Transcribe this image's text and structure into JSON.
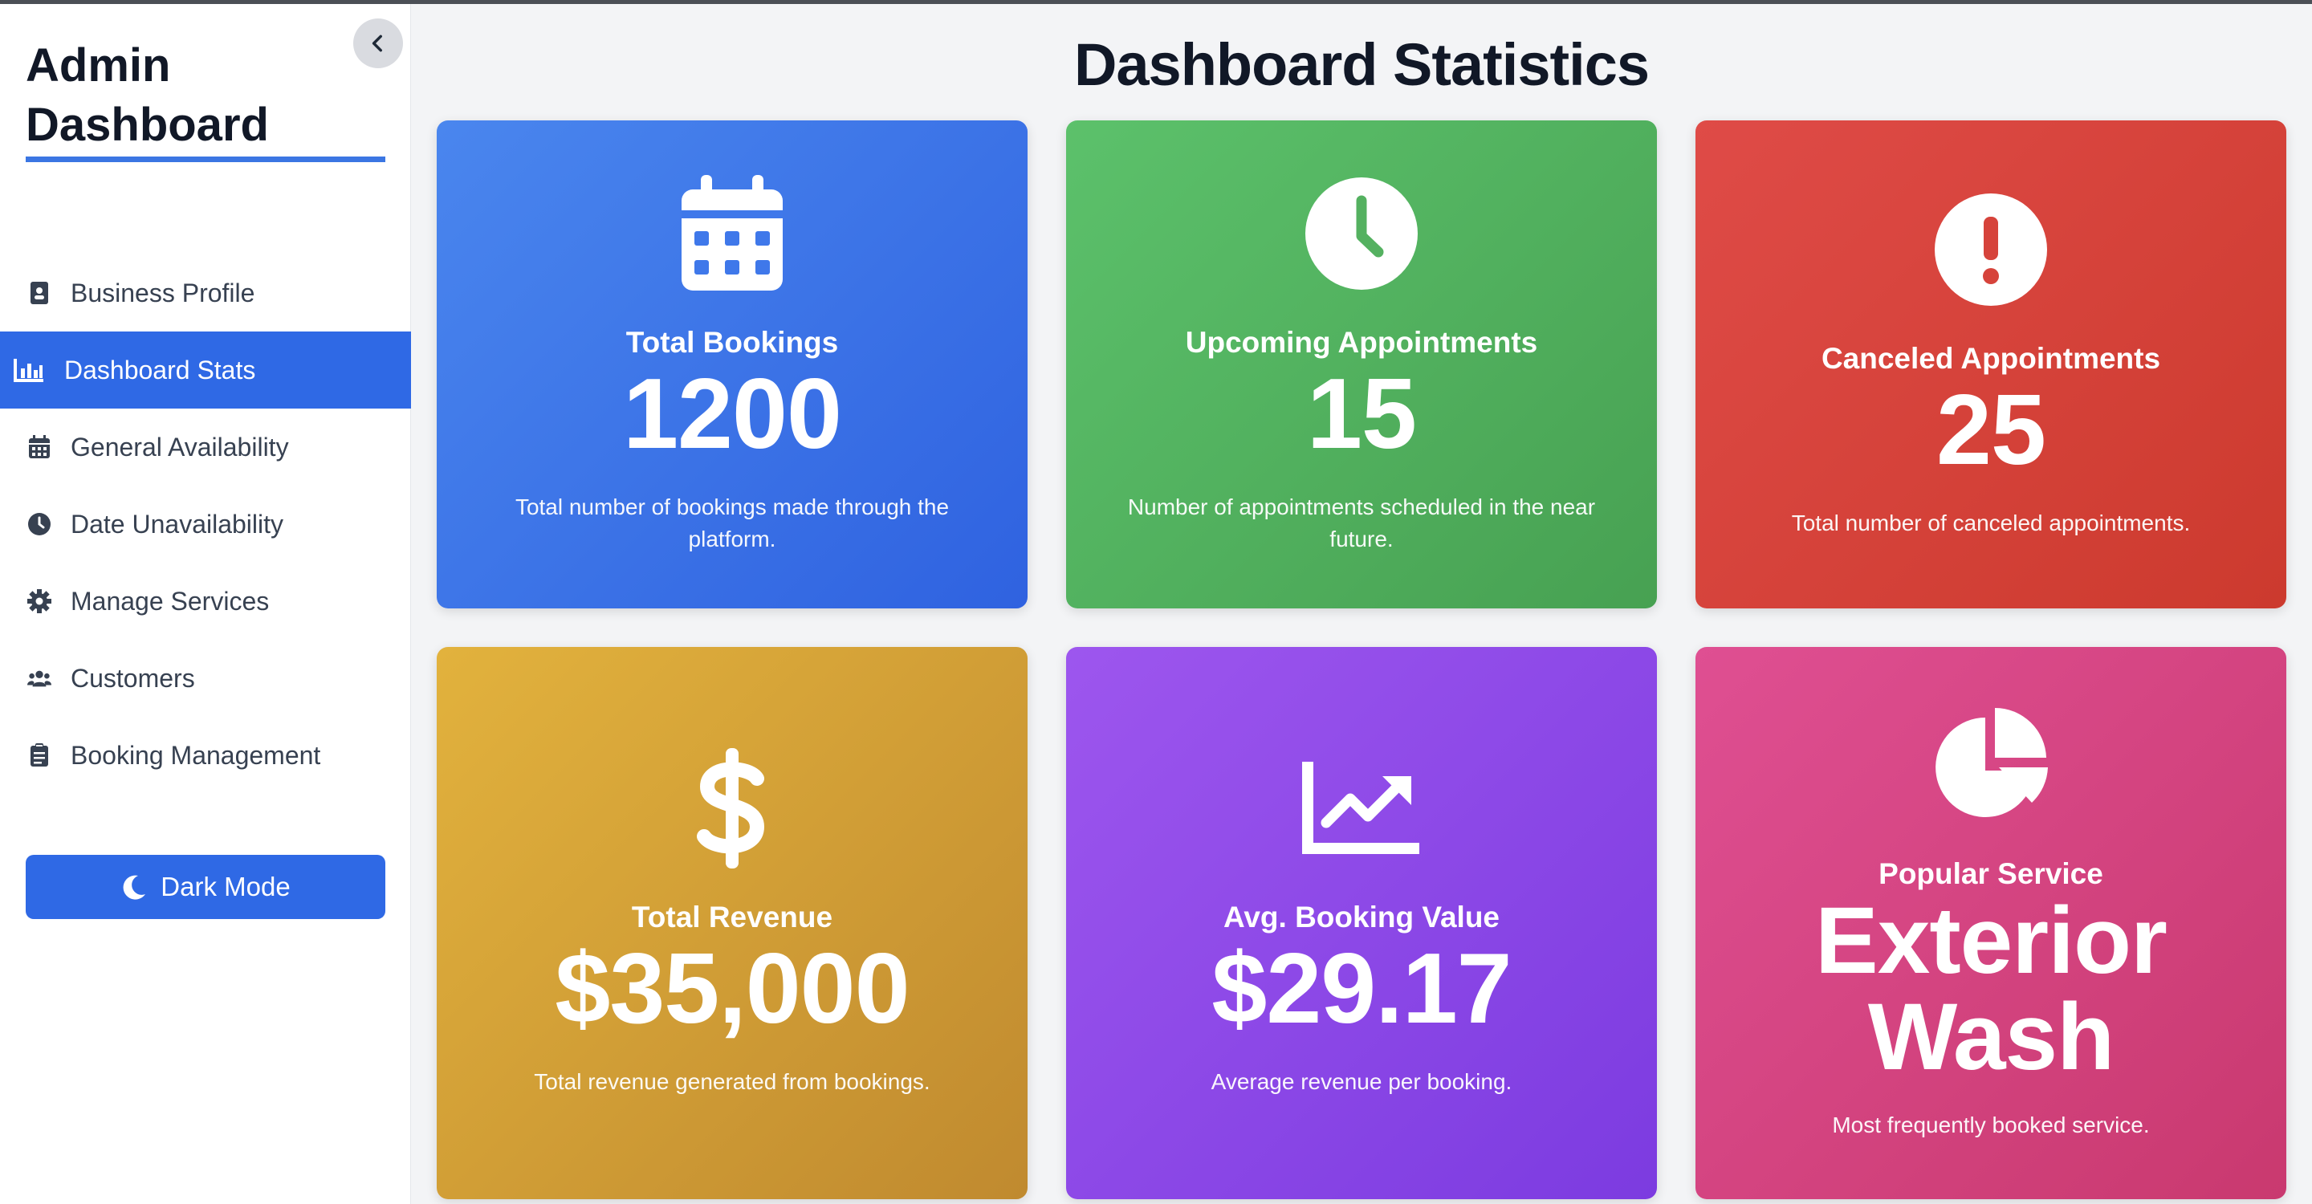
{
  "sidebar": {
    "title": "Admin Dashboard",
    "items": [
      {
        "label": "Business Profile",
        "icon": "id-badge-icon"
      },
      {
        "label": "Dashboard Stats",
        "icon": "bar-chart-icon",
        "active": true
      },
      {
        "label": "General Availability",
        "icon": "calendar-icon"
      },
      {
        "label": "Date Unavailability",
        "icon": "clock-icon"
      },
      {
        "label": "Manage Services",
        "icon": "gear-icon"
      },
      {
        "label": "Customers",
        "icon": "users-icon"
      },
      {
        "label": "Booking Management",
        "icon": "clipboard-icon"
      }
    ],
    "dark_mode_label": "Dark Mode"
  },
  "main": {
    "title": "Dashboard Statistics",
    "cards": [
      {
        "title": "Total Bookings",
        "value": "1200",
        "desc": "Total number of bookings made through the platform.",
        "icon": "calendar-icon",
        "color": "#3b76e8"
      },
      {
        "title": "Upcoming Appointments",
        "value": "15",
        "desc": "Number of appointments scheduled in the near future.",
        "icon": "clock-icon",
        "color": "#52b25e"
      },
      {
        "title": "Canceled Appointments",
        "value": "25",
        "desc": "Total number of canceled appointments.",
        "icon": "exclamation-circle-icon",
        "color": "#d6433b"
      },
      {
        "title": "Total Revenue",
        "value": "$35,000",
        "desc": "Total revenue generated from bookings.",
        "icon": "dollar-icon",
        "color": "#d19e36"
      },
      {
        "title": "Avg. Booking Value",
        "value": "$29.17",
        "desc": "Average revenue per booking.",
        "icon": "trend-chart-icon",
        "color": "#8c48e7"
      },
      {
        "title": "Popular Service",
        "value": "Exterior Wash",
        "desc": "Most frequently booked service.",
        "icon": "pie-chart-icon",
        "color": "#d44481"
      }
    ]
  },
  "colors": {
    "accent": "#2f69e5",
    "text_dark": "#111827",
    "sidebar_text": "#374151"
  }
}
